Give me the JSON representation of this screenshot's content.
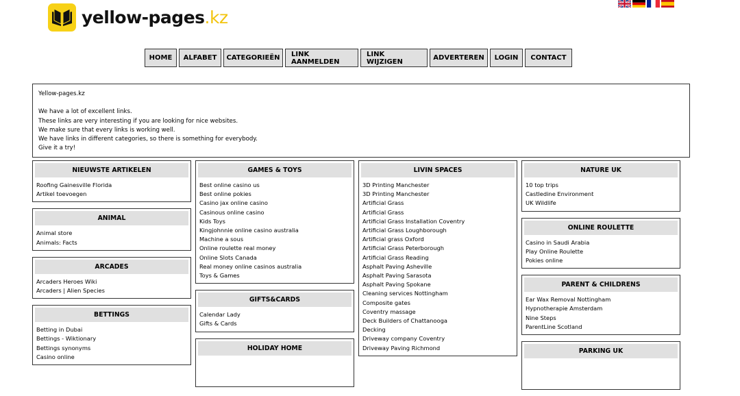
{
  "header": {
    "logo_text": "yellow-pages",
    "logo_ext": ".kz",
    "flags": [
      {
        "name": "english-flag-icon"
      },
      {
        "name": "german-flag-icon"
      },
      {
        "name": "french-flag-icon"
      },
      {
        "name": "spanish-flag-icon"
      }
    ]
  },
  "nav": [
    "HOME",
    "ALFABET",
    "CATEGORIEËN",
    "LINK AANMELDEN",
    "LINK WIJZIGEN",
    "ADVERTEREN",
    "LOGIN",
    "CONTACT"
  ],
  "intro": {
    "title": "Yellow-pages.kz",
    "lines": [
      "We have a lot of excellent links.",
      "These links are very interesting if you are looking for nice websites.",
      "We make sure that every links is working well.",
      "We have links in different categories, so there is something for everybody.",
      "Give it a try!"
    ]
  },
  "columns": [
    [
      {
        "title": "NIEUWSTE ARTIKELEN",
        "items": [
          "Roofing Gainesville Florida",
          "Artikel toevoegen"
        ]
      },
      {
        "title": "ANIMAL",
        "items": [
          "Animal store",
          "Animals: Facts"
        ]
      },
      {
        "title": "ARCADES",
        "items": [
          "Arcaders Heroes Wiki",
          "Arcaders | Alien Species"
        ]
      },
      {
        "title": "BETTINGS",
        "items": [
          "Betting in Dubai",
          "Bettings - Wiktionary",
          "Bettings synonyms",
          "Casino online"
        ]
      }
    ],
    [
      {
        "title": "GAMES & TOYS",
        "items": [
          "Best online casino us",
          "Best online pokies",
          "Casino jax online casino",
          "Casinous online casino",
          "Kids Toys",
          "Kingjohnnie online casino australia",
          "Machine a sous",
          "Online roulette real money",
          "Online Slots Canada",
          "Real money online casinos australia",
          "Toys & Games"
        ]
      },
      {
        "title": "GIFTS&CARDS",
        "items": [
          "Calendar Lady",
          "Gifts & Cards"
        ]
      },
      {
        "title": "HOLIDAY HOME",
        "items": []
      }
    ],
    [
      {
        "title": "LIVIN SPACES",
        "items": [
          "3D Printing Manchester",
          "3D Printing Manchester",
          "Artificial Grass",
          "Artificial Grass",
          "Artificial Grass Installation Coventry",
          "Artificial Grass Loughborough",
          "Artificial grass Oxford",
          "Artificial Grass Peterborough",
          "Artificial Grass Reading",
          "Asphalt Paving Asheville",
          "Asphalt Paving Sarasota",
          "Asphalt Paving Spokane",
          "Cleaning services Nottingham",
          "Composite gates",
          "Coventry massage",
          "Deck Builders of Chattanooga",
          "Decking",
          "Driveway company Coventry",
          "Driveway Paving Richmond"
        ]
      }
    ],
    [
      {
        "title": "NATURE UK",
        "items": [
          "10 top trips",
          "Castledine Environment",
          "UK Wildlife"
        ]
      },
      {
        "title": "ONLINE ROULETTE",
        "items": [
          "Casino in Saudi Arabia",
          "Play Online Roulette",
          "Pokies online"
        ]
      },
      {
        "title": "PARENT & CHILDRENS",
        "items": [
          "Ear Wax Removal Nottingham",
          "Hypnotherapie Amsterdam",
          "Nine Steps",
          "ParentLine Scotland"
        ]
      },
      {
        "title": "PARKING UK",
        "items": []
      }
    ]
  ]
}
